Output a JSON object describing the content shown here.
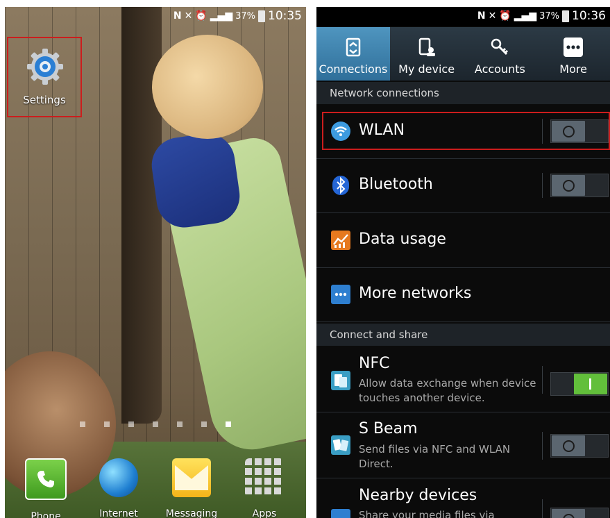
{
  "left": {
    "status_time": "10:35",
    "battery": "37%",
    "settings_label": "Settings",
    "page_dots": 7,
    "active_dot": 6,
    "dock": [
      {
        "id": "phone",
        "label": "Phone"
      },
      {
        "id": "internet",
        "label": "Internet"
      },
      {
        "id": "messaging",
        "label": "Messaging"
      },
      {
        "id": "apps",
        "label": "Apps"
      }
    ]
  },
  "right": {
    "status_time": "10:36",
    "battery": "37%",
    "tabs": [
      {
        "label": "Connections",
        "active": true,
        "icon": "connections-icon"
      },
      {
        "label": "My device",
        "active": false,
        "icon": "my-device-icon"
      },
      {
        "label": "Accounts",
        "active": false,
        "icon": "accounts-icon"
      },
      {
        "label": "More",
        "active": false,
        "icon": "more-icon"
      }
    ],
    "section_network": "Network connections",
    "wlan": "WLAN",
    "bluetooth": "Bluetooth",
    "data_usage": "Data usage",
    "more_networks": "More networks",
    "section_share": "Connect and share",
    "nfc": {
      "title": "NFC",
      "sub": "Allow data exchange when device touches another device."
    },
    "sbeam": {
      "title": "S Beam",
      "sub": "Send files via NFC and WLAN Direct."
    },
    "nearby": {
      "title": "Nearby devices",
      "sub": "Share your media files via"
    },
    "colors": {
      "accent": "#3f83b0",
      "toggle_on": "#62bf3b",
      "highlight": "#cc1d1d"
    }
  }
}
